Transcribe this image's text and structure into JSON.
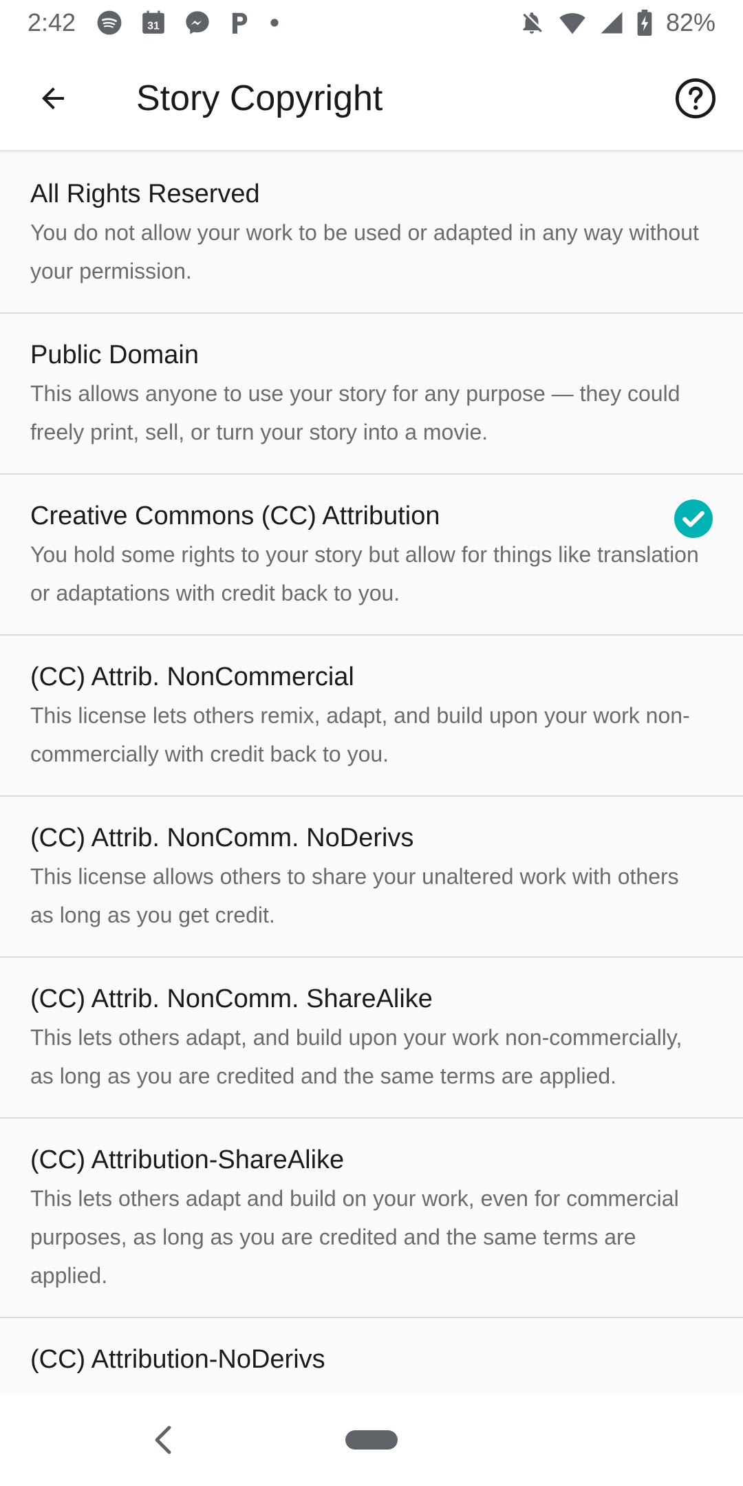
{
  "status_bar": {
    "time": "2:42",
    "left_icons": [
      "spotify-icon",
      "calendar-icon",
      "messenger-icon",
      "p-app-icon",
      "dot-icon"
    ],
    "calendar_day": "31",
    "right_icons": [
      "notifications-off-icon",
      "wifi-icon",
      "cell-signal-icon",
      "battery-charging-icon"
    ],
    "battery_percent": "82%"
  },
  "app_bar": {
    "back_icon": "arrow-back-icon",
    "title": "Story Copyright",
    "help_icon": "help-circle-icon"
  },
  "licenses": [
    {
      "title": "All Rights Reserved",
      "description": "You do not allow your work to be used or adapted in any way without your permission.",
      "selected": false
    },
    {
      "title": "Public Domain",
      "description": "This allows anyone to use your story for any purpose — they could freely print, sell, or turn your story into a movie.",
      "selected": false
    },
    {
      "title": "Creative Commons (CC) Attribution",
      "description": "You hold some rights to your story but allow for things like translation or adaptations with credit back to you.",
      "selected": true
    },
    {
      "title": "(CC) Attrib. NonCommercial",
      "description": "This license lets others remix, adapt, and build upon your work non-commercially with credit back to you.",
      "selected": false
    },
    {
      "title": "(CC) Attrib. NonComm. NoDerivs",
      "description": "This license allows others to share your unaltered work with others as long as you get credit.",
      "selected": false
    },
    {
      "title": "(CC) Attrib. NonComm. ShareAlike",
      "description": "This lets others adapt, and build upon your work non-commercially, as long as you are credited and the same terms are applied.",
      "selected": false
    },
    {
      "title": "(CC) Attribution-ShareAlike",
      "description": "This lets others adapt and build on your work, even for commercial purposes, as long as you are credited and the same terms are applied.",
      "selected": false
    },
    {
      "title": "(CC) Attribution-NoDerivs",
      "description": "",
      "selected": false
    }
  ],
  "colors": {
    "accent": "#00b2b2",
    "title_text": "#1a1a1a",
    "desc_text": "#6b6b6b",
    "divider": "#d9d9d9"
  },
  "nav_bar": {
    "back_icon": "nav-back-icon",
    "home_icon": "nav-home-pill-icon"
  }
}
